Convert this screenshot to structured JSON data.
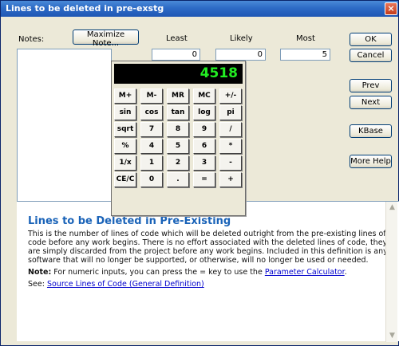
{
  "window": {
    "title": "Lines to be deleted in pre-exstg",
    "close_label": "×"
  },
  "notes": {
    "label": "Notes:",
    "maximize_label": "Maximize Note..."
  },
  "estimates": {
    "least_label": "Least",
    "likely_label": "Likely",
    "most_label": "Most",
    "least_value": "0",
    "likely_value": "0",
    "most_value": "5"
  },
  "buttons": {
    "ok": "OK",
    "cancel": "Cancel",
    "prev": "Prev",
    "next": "Next",
    "kbase": "KBase",
    "more_help": "More Help"
  },
  "calculator": {
    "display": "4518",
    "keys": [
      [
        "M+",
        "M-",
        "MR",
        "MC",
        "+/-"
      ],
      [
        "sin",
        "cos",
        "tan",
        "log",
        "pi"
      ],
      [
        "sqrt",
        "7",
        "8",
        "9",
        "/"
      ],
      [
        "%",
        "4",
        "5",
        "6",
        "*"
      ],
      [
        "1/x",
        "1",
        "2",
        "3",
        "-"
      ],
      [
        "CE/C",
        "0",
        ".",
        "=",
        "+"
      ]
    ]
  },
  "help": {
    "title": "Lines to be Deleted in Pre-Existing",
    "body": "This is the number of lines of code which will be deleted outright from the pre-existing lines of code before any work begins. There is no effort associated with the deleted lines of code, they are simply discarded from the project before any work begins. Included in this definition is any software that will no longer be supported, or otherwise, will no longer be used or needed.",
    "note_label": "Note:",
    "note_text": "For numeric inputs, you can press the = key to use the",
    "note_link": "Parameter Calculator",
    "note_end": ".",
    "see_label": "See:",
    "see_link": "Source Lines of Code (General Definition)"
  },
  "scroll": {
    "up_icon": "scroll-up-arrow",
    "down_icon": "scroll-down-arrow"
  }
}
